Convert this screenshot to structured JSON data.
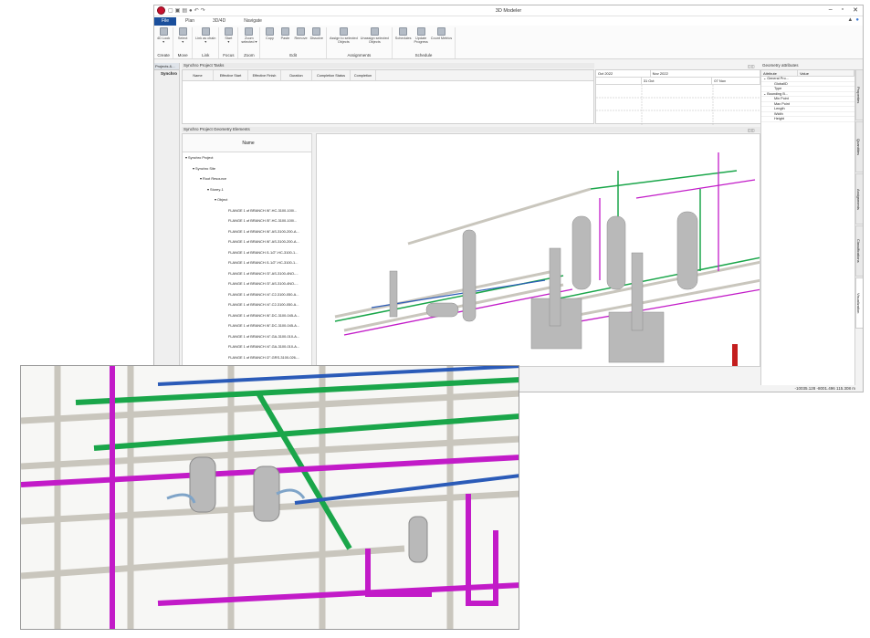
{
  "window": {
    "title": "3D Modeler",
    "minimize": "–",
    "restore": "▫",
    "close": "✕"
  },
  "tabs": [
    "File",
    "Plan",
    "3D/4D",
    "Navigate"
  ],
  "ribbon": {
    "groups": [
      {
        "title": "Create",
        "buttons": [
          "4D Look\n▾"
        ]
      },
      {
        "title": "Move",
        "buttons": [
          "Select\n▾"
        ]
      },
      {
        "title": "Link",
        "buttons": [
          "Link as chain\n▾"
        ]
      },
      {
        "title": "Focus",
        "buttons": [
          "Start\n▾"
        ]
      },
      {
        "title": "Zoom",
        "buttons": [
          "Zoom\nselected ▾"
        ]
      },
      {
        "title": "Edit",
        "buttons": [
          "Copy",
          "Paste",
          "Remove",
          "Dissolve"
        ]
      },
      {
        "title": "Assignments",
        "buttons": [
          "Assign to selected\nObjects",
          "Unassign selected\nObjects"
        ]
      },
      {
        "title": "Schedule",
        "buttons": [
          "Schedules",
          "Update\nProgress",
          "Count Metrics"
        ]
      }
    ]
  },
  "left_strip": {
    "tab": "Projects &...",
    "item": "Synchro"
  },
  "tasks_panel": {
    "title": "Synchro Project Tasks",
    "columns": [
      "Name",
      "Effective Start",
      "Effective Finish",
      "Duration",
      "Completion Status",
      "Completion"
    ]
  },
  "gantt": {
    "months": [
      "Oct 2022",
      "Nov 2022"
    ],
    "days": [
      "31 Oct",
      "07 Nov"
    ]
  },
  "attributes": {
    "title": "Geometry attributes",
    "columns": [
      "Attribute",
      "Value"
    ],
    "rows": [
      "⌄ General Pro...",
      "GlobalID",
      "Type",
      "⌄ Bounding B...",
      "Min Point",
      "Max Point",
      "Length",
      "Width",
      "Height"
    ]
  },
  "side_tabs": [
    "Properties",
    "Quantities",
    "Assignments",
    "Classifications",
    "Visualization"
  ],
  "elements_panel": {
    "title": "Synchro Project Geometry Elements",
    "column": "Name",
    "tree": [
      "▾ Synchro Project",
      "▾ Synchro Site",
      "▾ Root Resource",
      "▾ Storey-1",
      "▾ Object",
      "FLANGE 1 of BRANCH /6\"-HC-3100-100/...",
      "FLANGE 1 of BRANCH /5\"-HC-3100-100/...",
      "FLANGE 1 of BRANCH /6\"-AS-3100-200-A...",
      "FLANGE 1 of BRANCH /6\"-AS-3100-200-A...",
      "FLANGE 1 of BRANCH /1.1/2\"-HC-3100-1...",
      "FLANGE 1 of BRANCH /1.1/2\"-HC-3100-1...",
      "FLANGE 1 of BRANCH /3\"-AS-3100-4NO-...",
      "FLANGE 1 of BRANCH /3\"-AS-3100-4NO-...",
      "FLANGE 1 of BRANCH /4\"-C2-3100-050-A...",
      "FLANGE 1 of BRANCH /4\"-C2-3100-050-A...",
      "FLANGE 1 of BRANCH /6\"-DC-3100-045-A...",
      "FLANGE 1 of BRANCH /6\"-DC-3100-045-A...",
      "FLANGE 1 of BRANCH /4\"-GA-3100-010-A...",
      "FLANGE 1 of BRANCH /4\"-GA-3100-010-A...",
      "FLANGE 1 of BRANCH /2\"-GRS-3100-026-..."
    ]
  },
  "status": {
    "coords": "-10035.128 -8001.496 115.308 m"
  },
  "colors": {
    "accent": "#1a4f9c",
    "pipe_green": "#1aa64a",
    "pipe_magenta": "#c21bc8",
    "pipe_grey": "#c9c6bd",
    "pipe_blue": "#2b5bb8"
  }
}
